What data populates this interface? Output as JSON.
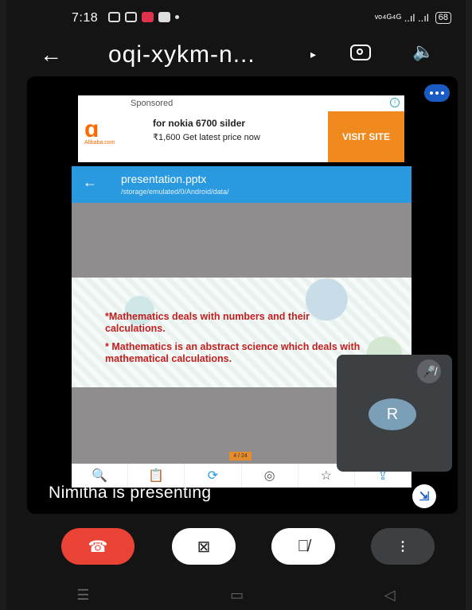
{
  "status_bar": {
    "time": "7:18",
    "network": "ᵛᵒ⁴ᴳ⁴ᴳ ..ıl ..ıl",
    "battery": "68"
  },
  "top_bar": {
    "meeting_code": "oqi-xykm-n...",
    "play_glyph": "▸"
  },
  "ad": {
    "sponsored": "Sponsored",
    "logo_text": "Alibaba.com",
    "headline": "for nokia 6700 silder",
    "subtext": "₹1,600 Get latest price now",
    "cta": "VISIT SITE"
  },
  "viewer": {
    "filename": "presentation.pptx",
    "path": "/storage/emulated/0/Android/data/",
    "slide_line1": "*Mathematics deals with numbers and their calculations.",
    "slide_line2": "* Mathematics is an abstract science which deals with  mathematical calculations.",
    "page_indicator": "4 / 24",
    "tools": [
      "search",
      "clipboard",
      "rotate",
      "focus",
      "star",
      "share"
    ]
  },
  "presenter_label": "Nimitha is presenting",
  "participant": {
    "initial": "R",
    "muted": true
  },
  "controls": {
    "end_call": "end-call",
    "camera": "camera-off",
    "mic": "mic-off",
    "more": "more-options"
  },
  "colors": {
    "end_call": "#ea4335",
    "accent": "#1a5cc4",
    "header": "#2a9ae0",
    "cta": "#f0891e"
  }
}
